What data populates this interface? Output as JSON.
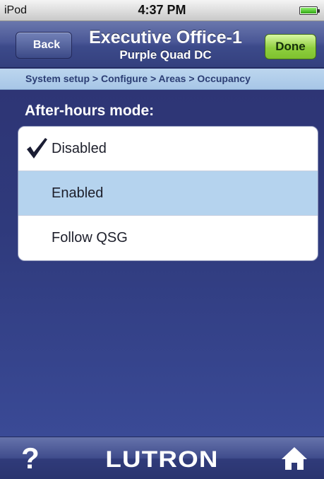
{
  "status_bar": {
    "carrier": "iPod",
    "time": "4:37 PM"
  },
  "nav": {
    "back_label": "Back",
    "title": "Executive Office-1",
    "subtitle": "Purple Quad DC",
    "done_label": "Done"
  },
  "breadcrumb": "System setup > Configure > Areas > Occupancy",
  "section_title": "After-hours mode:",
  "options": [
    {
      "label": "Disabled",
      "checked": true,
      "highlighted": false
    },
    {
      "label": "Enabled",
      "checked": false,
      "highlighted": true
    },
    {
      "label": "Follow QSG",
      "checked": false,
      "highlighted": false
    }
  ],
  "toolbar": {
    "help_label": "?",
    "logo_text": "LUTRON",
    "home_icon": "home-icon"
  },
  "colors": {
    "nav_background": "#4a5796",
    "breadcrumb_background": "#b5d3ee",
    "main_background": "#2f3a7c",
    "done_button": "#8fcf3f",
    "highlight_row": "#b5d3ee"
  }
}
